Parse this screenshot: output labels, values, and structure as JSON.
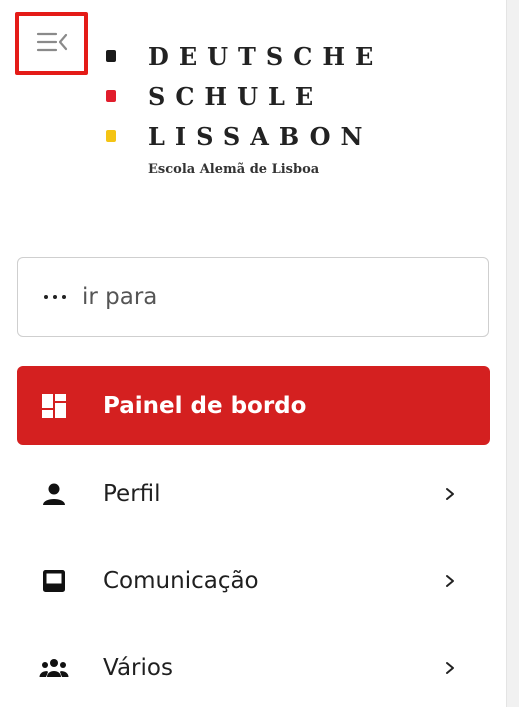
{
  "logo": {
    "lines": [
      "DEUTSCHE",
      "SCHULE",
      "LISSABON"
    ],
    "dot_colors": [
      "#1a1a1a",
      "#e11d2c",
      "#f4c414"
    ],
    "subtitle": "Escola Alemã de Lisboa"
  },
  "sidebar_toggle": {
    "icon": "menu-collapse-icon"
  },
  "search": {
    "placeholder": "ir para",
    "value": ""
  },
  "nav": {
    "active": {
      "label": "Painel de bordo",
      "icon": "dashboard-icon"
    },
    "items": [
      {
        "label": "Perfil",
        "icon": "person-icon"
      },
      {
        "label": "Comunicação",
        "icon": "inbox-icon"
      },
      {
        "label": "Vários",
        "icon": "group-icon"
      }
    ]
  },
  "colors": {
    "accent": "#d42020",
    "highlight_frame": "#e41b17",
    "text": "#1f1f1f"
  }
}
